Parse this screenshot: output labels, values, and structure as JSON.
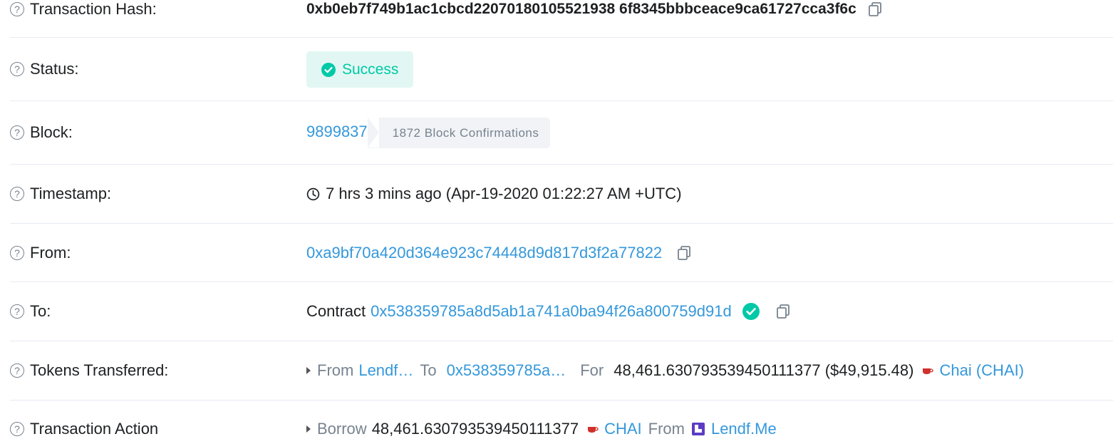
{
  "rows": {
    "hash": {
      "label": "Transaction Hash:",
      "value": "0xb0eb7f749b1ac1cbcd22070180105521938 6f8345bbbceace9ca61727cca3f6c"
    },
    "status": {
      "label": "Status:",
      "value": "Success"
    },
    "block": {
      "label": "Block:",
      "number": "9899837",
      "confirmations": "1872 Block Confirmations"
    },
    "timestamp": {
      "label": "Timestamp:",
      "value": "7 hrs 3 mins ago (Apr-19-2020 01:22:27 AM +UTC)"
    },
    "from": {
      "label": "From:",
      "address": "0xa9bf70a420d364e923c74448d9d817d3f2a77822"
    },
    "to": {
      "label": "To:",
      "prefix": "Contract",
      "address": "0x538359785a8d5ab1a741a0ba94f26a800759d91d"
    },
    "tokens": {
      "label": "Tokens Transferred:",
      "from_word": "From",
      "from_value": "Lendf…",
      "to_word": "To",
      "to_value": "0x538359785a…",
      "for_word": "For",
      "amount": "48,461.630793539450111377 ($49,915.48)",
      "token": "Chai (CHAI)"
    },
    "action": {
      "label": "Transaction Action",
      "verb": "Borrow",
      "amount": "48,461.630793539450111377",
      "token": "CHAI",
      "from_word": "From",
      "platform": "Lendf.Me"
    }
  },
  "colors": {
    "link": "#3498db",
    "success": "#00c9a7",
    "success_bg": "#e2f7f3",
    "muted": "#77838f"
  }
}
